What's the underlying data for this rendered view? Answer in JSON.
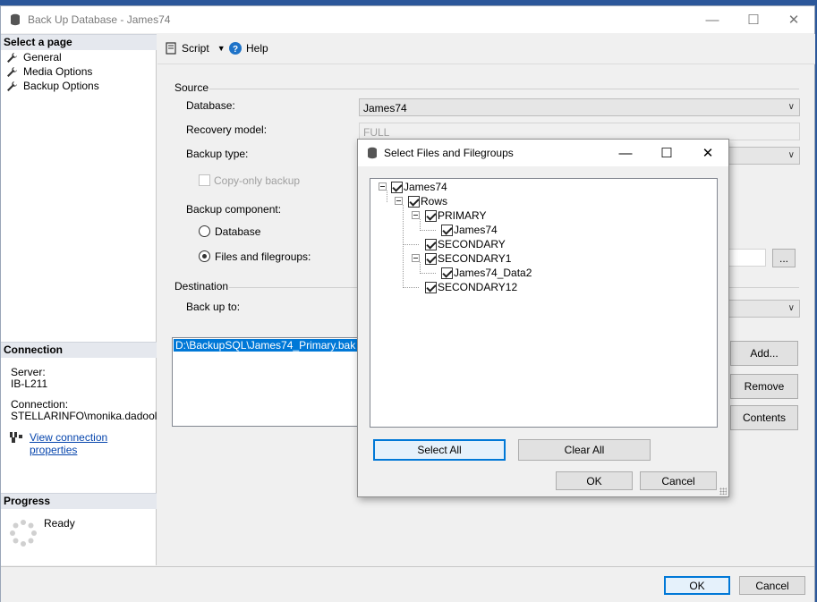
{
  "window": {
    "title": "Back Up Database - James74",
    "minimize_icon": "minimize-icon",
    "maximize_icon": "maximize-icon",
    "close_icon": "close-icon"
  },
  "left_pane": {
    "select_page_header": "Select a page",
    "pages": [
      {
        "label": "General",
        "icon": "wrench-icon"
      },
      {
        "label": "Media Options",
        "icon": "wrench-icon"
      },
      {
        "label": "Backup Options",
        "icon": "wrench-icon"
      }
    ],
    "connection_header": "Connection",
    "server_label": "Server:",
    "server_value": "IB-L211",
    "connection_label": "Connection:",
    "connection_value": "STELLARINFO\\monika.dadool",
    "view_connection_link": "View connection properties",
    "progress_header": "Progress",
    "progress_status": "Ready"
  },
  "toolbar": {
    "script_label": "Script",
    "help_label": "Help"
  },
  "form": {
    "source_label": "Source",
    "database_label": "Database:",
    "database_value": "James74",
    "recovery_model_label": "Recovery model:",
    "recovery_model_value": "FULL",
    "backup_type_label": "Backup type:",
    "copy_only_label": "Copy-only backup",
    "backup_component_label": "Backup component:",
    "component_database_label": "Database",
    "component_files_label": "Files and filegroups:",
    "browse_button": "...",
    "destination_label": "Destination",
    "back_up_to_label": "Back up to:",
    "destination_path": "D:\\BackupSQL\\James74_Primary.bak",
    "add_button": "Add...",
    "remove_button": "Remove",
    "contents_button": "Contents"
  },
  "footer": {
    "ok_button": "OK",
    "cancel_button": "Cancel"
  },
  "dialog": {
    "title": "Select Files and Filegroups",
    "tree": [
      {
        "label": "James74",
        "checked": true
      },
      {
        "label": "Rows",
        "checked": true
      },
      {
        "label": "PRIMARY",
        "checked": true
      },
      {
        "label": "James74",
        "checked": true
      },
      {
        "label": "SECONDARY",
        "checked": true
      },
      {
        "label": "SECONDARY1",
        "checked": true
      },
      {
        "label": "James74_Data2",
        "checked": true
      },
      {
        "label": "SECONDARY12",
        "checked": true
      }
    ],
    "select_all_button": "Select All",
    "clear_all_button": "Clear All",
    "ok_button": "OK",
    "cancel_button": "Cancel"
  }
}
